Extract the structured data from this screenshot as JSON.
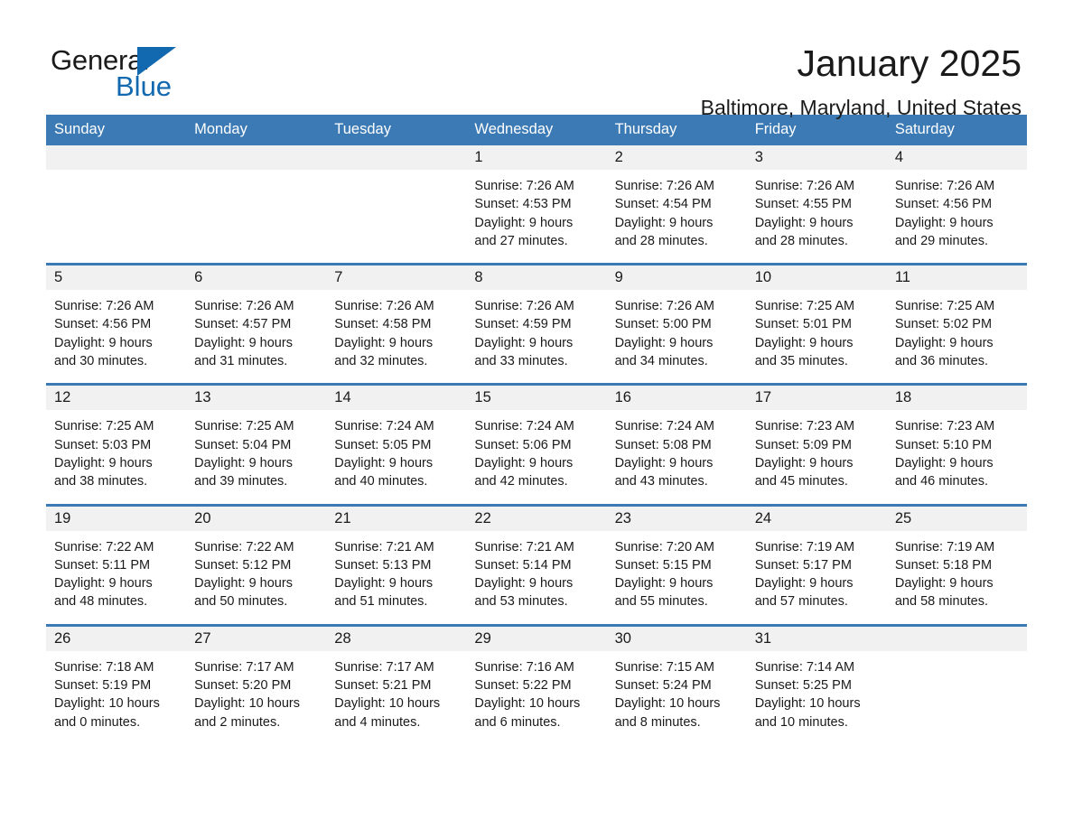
{
  "brand": {
    "name_part1": "General",
    "name_part2": "Blue",
    "accent_color": "#1269b0"
  },
  "header": {
    "title": "January 2025",
    "subtitle": "Baltimore, Maryland, United States"
  },
  "theme": {
    "header_blue": "#3b7ab5",
    "daynum_gray": "#f1f1f1",
    "text_color": "#1a1a1a"
  },
  "weekday_headers": [
    "Sunday",
    "Monday",
    "Tuesday",
    "Wednesday",
    "Thursday",
    "Friday",
    "Saturday"
  ],
  "weeks": [
    [
      {
        "day": "",
        "lines": []
      },
      {
        "day": "",
        "lines": []
      },
      {
        "day": "",
        "lines": []
      },
      {
        "day": "1",
        "lines": [
          "Sunrise: 7:26 AM",
          "Sunset: 4:53 PM",
          "Daylight: 9 hours",
          "and 27 minutes."
        ]
      },
      {
        "day": "2",
        "lines": [
          "Sunrise: 7:26 AM",
          "Sunset: 4:54 PM",
          "Daylight: 9 hours",
          "and 28 minutes."
        ]
      },
      {
        "day": "3",
        "lines": [
          "Sunrise: 7:26 AM",
          "Sunset: 4:55 PM",
          "Daylight: 9 hours",
          "and 28 minutes."
        ]
      },
      {
        "day": "4",
        "lines": [
          "Sunrise: 7:26 AM",
          "Sunset: 4:56 PM",
          "Daylight: 9 hours",
          "and 29 minutes."
        ]
      }
    ],
    [
      {
        "day": "5",
        "lines": [
          "Sunrise: 7:26 AM",
          "Sunset: 4:56 PM",
          "Daylight: 9 hours",
          "and 30 minutes."
        ]
      },
      {
        "day": "6",
        "lines": [
          "Sunrise: 7:26 AM",
          "Sunset: 4:57 PM",
          "Daylight: 9 hours",
          "and 31 minutes."
        ]
      },
      {
        "day": "7",
        "lines": [
          "Sunrise: 7:26 AM",
          "Sunset: 4:58 PM",
          "Daylight: 9 hours",
          "and 32 minutes."
        ]
      },
      {
        "day": "8",
        "lines": [
          "Sunrise: 7:26 AM",
          "Sunset: 4:59 PM",
          "Daylight: 9 hours",
          "and 33 minutes."
        ]
      },
      {
        "day": "9",
        "lines": [
          "Sunrise: 7:26 AM",
          "Sunset: 5:00 PM",
          "Daylight: 9 hours",
          "and 34 minutes."
        ]
      },
      {
        "day": "10",
        "lines": [
          "Sunrise: 7:25 AM",
          "Sunset: 5:01 PM",
          "Daylight: 9 hours",
          "and 35 minutes."
        ]
      },
      {
        "day": "11",
        "lines": [
          "Sunrise: 7:25 AM",
          "Sunset: 5:02 PM",
          "Daylight: 9 hours",
          "and 36 minutes."
        ]
      }
    ],
    [
      {
        "day": "12",
        "lines": [
          "Sunrise: 7:25 AM",
          "Sunset: 5:03 PM",
          "Daylight: 9 hours",
          "and 38 minutes."
        ]
      },
      {
        "day": "13",
        "lines": [
          "Sunrise: 7:25 AM",
          "Sunset: 5:04 PM",
          "Daylight: 9 hours",
          "and 39 minutes."
        ]
      },
      {
        "day": "14",
        "lines": [
          "Sunrise: 7:24 AM",
          "Sunset: 5:05 PM",
          "Daylight: 9 hours",
          "and 40 minutes."
        ]
      },
      {
        "day": "15",
        "lines": [
          "Sunrise: 7:24 AM",
          "Sunset: 5:06 PM",
          "Daylight: 9 hours",
          "and 42 minutes."
        ]
      },
      {
        "day": "16",
        "lines": [
          "Sunrise: 7:24 AM",
          "Sunset: 5:08 PM",
          "Daylight: 9 hours",
          "and 43 minutes."
        ]
      },
      {
        "day": "17",
        "lines": [
          "Sunrise: 7:23 AM",
          "Sunset: 5:09 PM",
          "Daylight: 9 hours",
          "and 45 minutes."
        ]
      },
      {
        "day": "18",
        "lines": [
          "Sunrise: 7:23 AM",
          "Sunset: 5:10 PM",
          "Daylight: 9 hours",
          "and 46 minutes."
        ]
      }
    ],
    [
      {
        "day": "19",
        "lines": [
          "Sunrise: 7:22 AM",
          "Sunset: 5:11 PM",
          "Daylight: 9 hours",
          "and 48 minutes."
        ]
      },
      {
        "day": "20",
        "lines": [
          "Sunrise: 7:22 AM",
          "Sunset: 5:12 PM",
          "Daylight: 9 hours",
          "and 50 minutes."
        ]
      },
      {
        "day": "21",
        "lines": [
          "Sunrise: 7:21 AM",
          "Sunset: 5:13 PM",
          "Daylight: 9 hours",
          "and 51 minutes."
        ]
      },
      {
        "day": "22",
        "lines": [
          "Sunrise: 7:21 AM",
          "Sunset: 5:14 PM",
          "Daylight: 9 hours",
          "and 53 minutes."
        ]
      },
      {
        "day": "23",
        "lines": [
          "Sunrise: 7:20 AM",
          "Sunset: 5:15 PM",
          "Daylight: 9 hours",
          "and 55 minutes."
        ]
      },
      {
        "day": "24",
        "lines": [
          "Sunrise: 7:19 AM",
          "Sunset: 5:17 PM",
          "Daylight: 9 hours",
          "and 57 minutes."
        ]
      },
      {
        "day": "25",
        "lines": [
          "Sunrise: 7:19 AM",
          "Sunset: 5:18 PM",
          "Daylight: 9 hours",
          "and 58 minutes."
        ]
      }
    ],
    [
      {
        "day": "26",
        "lines": [
          "Sunrise: 7:18 AM",
          "Sunset: 5:19 PM",
          "Daylight: 10 hours",
          "and 0 minutes."
        ]
      },
      {
        "day": "27",
        "lines": [
          "Sunrise: 7:17 AM",
          "Sunset: 5:20 PM",
          "Daylight: 10 hours",
          "and 2 minutes."
        ]
      },
      {
        "day": "28",
        "lines": [
          "Sunrise: 7:17 AM",
          "Sunset: 5:21 PM",
          "Daylight: 10 hours",
          "and 4 minutes."
        ]
      },
      {
        "day": "29",
        "lines": [
          "Sunrise: 7:16 AM",
          "Sunset: 5:22 PM",
          "Daylight: 10 hours",
          "and 6 minutes."
        ]
      },
      {
        "day": "30",
        "lines": [
          "Sunrise: 7:15 AM",
          "Sunset: 5:24 PM",
          "Daylight: 10 hours",
          "and 8 minutes."
        ]
      },
      {
        "day": "31",
        "lines": [
          "Sunrise: 7:14 AM",
          "Sunset: 5:25 PM",
          "Daylight: 10 hours",
          "and 10 minutes."
        ]
      },
      {
        "day": "",
        "lines": []
      }
    ]
  ]
}
